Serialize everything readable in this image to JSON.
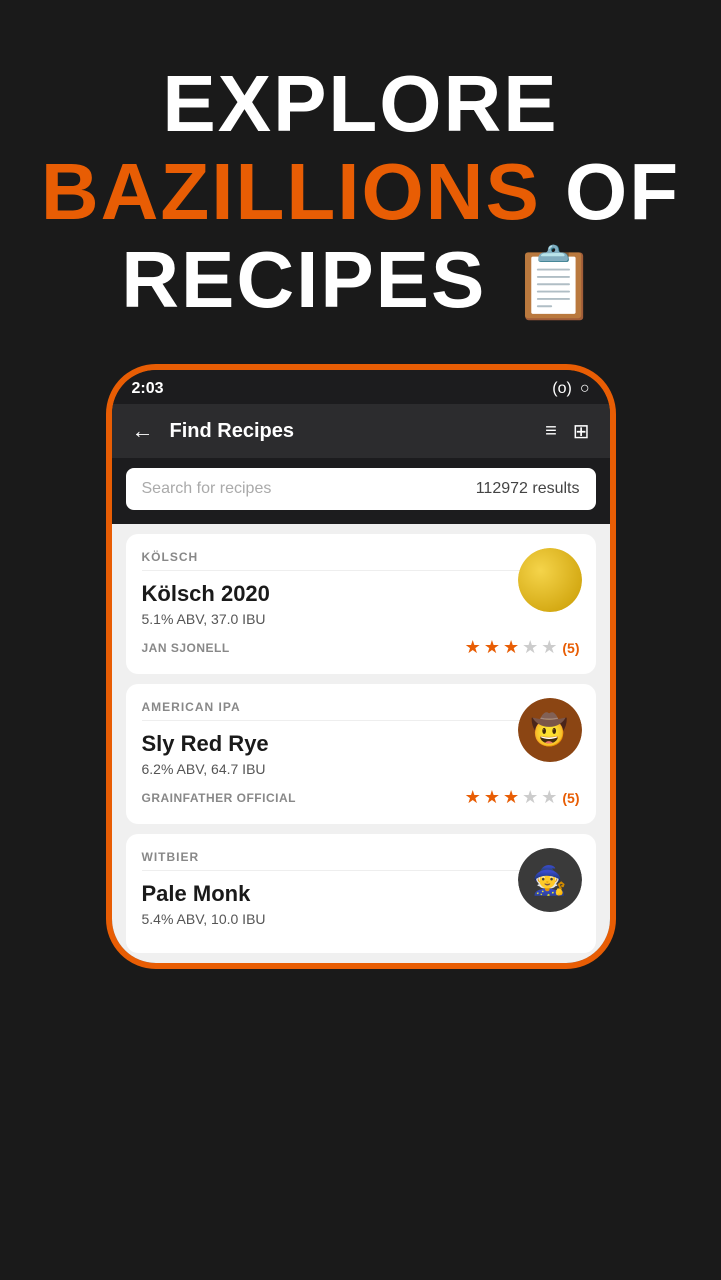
{
  "hero": {
    "line1": "EXPLORE",
    "line2_orange": "BAZILLIONS",
    "line2_white": " OF",
    "line3": "RECIPES",
    "recipe_icon": "📋"
  },
  "status_bar": {
    "time": "2:03",
    "signal_icon": "(o)",
    "battery_icon": "○"
  },
  "nav": {
    "title": "Find Recipes",
    "back_icon": "←",
    "filter_icon": "≡",
    "grid_icon": "⊞"
  },
  "search": {
    "placeholder": "Search for recipes",
    "results_count": "112972 results"
  },
  "recipes": [
    {
      "type": "KÖLSCH",
      "name": "Kölsch 2020",
      "abv": "5.1% ABV, 37.0 IBU",
      "author": "JAN SJONELL",
      "rating": 3,
      "max_rating": 5,
      "rating_count": "(5)",
      "thumb_type": "kolsch"
    },
    {
      "type": "AMERICAN IPA",
      "name": "Sly Red Rye",
      "abv": "6.2% ABV, 64.7 IBU",
      "author": "GRAINFATHER OFFICIAL",
      "rating": 3,
      "max_rating": 5,
      "rating_count": "(5)",
      "thumb_type": "slyrye"
    },
    {
      "type": "WITBIER",
      "name": "Pale Monk",
      "abv": "5.4% ABV, 10.0 IBU",
      "author": "",
      "rating": 0,
      "max_rating": 5,
      "rating_count": "",
      "thumb_type": "palemonk"
    }
  ]
}
